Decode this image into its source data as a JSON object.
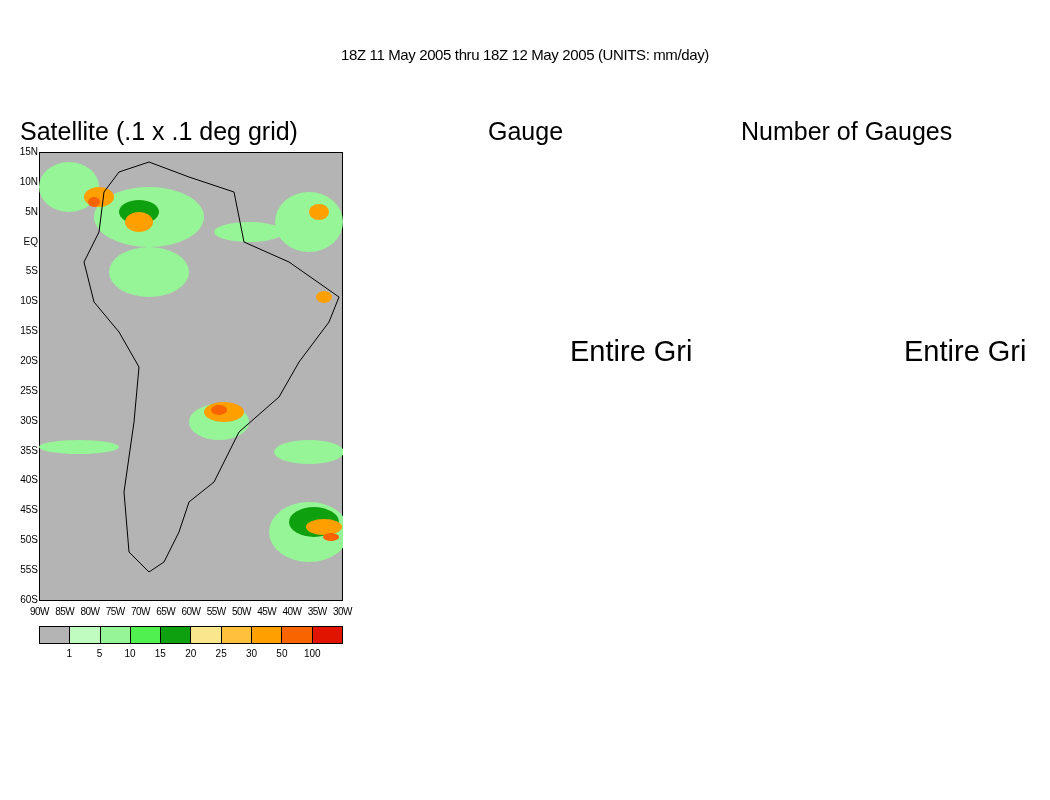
{
  "title": "18Z 11 May 2005 thru 18Z 12 May 2005 (UNITS: mm/day)",
  "panels": [
    {
      "kind": "map",
      "title": "Satellite (.1 x .1 deg grid)",
      "lat_labels": [
        "15N",
        "10N",
        "5N",
        "EQ",
        "5S",
        "10S",
        "15S",
        "20S",
        "25S",
        "30S",
        "35S",
        "40S",
        "45S",
        "50S",
        "55S",
        "60S"
      ],
      "lon_labels": [
        "90W",
        "85W",
        "80W",
        "75W",
        "70W",
        "65W",
        "60W",
        "55W",
        "50W",
        "45W",
        "40W",
        "35W",
        "30W"
      ],
      "legend": {
        "swatches": [
          {
            "color": "#b4b4b4"
          },
          {
            "color": "#c0fcc0"
          },
          {
            "color": "#96f596"
          },
          {
            "color": "#50f050"
          },
          {
            "color": "#0fa00f"
          },
          {
            "color": "#fae68c"
          },
          {
            "color": "#ffc03c"
          },
          {
            "color": "#ffa000"
          },
          {
            "color": "#fa6400"
          },
          {
            "color": "#e11400"
          }
        ],
        "labels": [
          "1",
          "5",
          "10",
          "15",
          "20",
          "25",
          "30",
          "50",
          "100"
        ]
      }
    },
    {
      "kind": "message",
      "title": "Gauge",
      "message": "Entire Gri"
    },
    {
      "kind": "message",
      "title": "Number of Gauges",
      "message": "Entire Gri"
    }
  ]
}
